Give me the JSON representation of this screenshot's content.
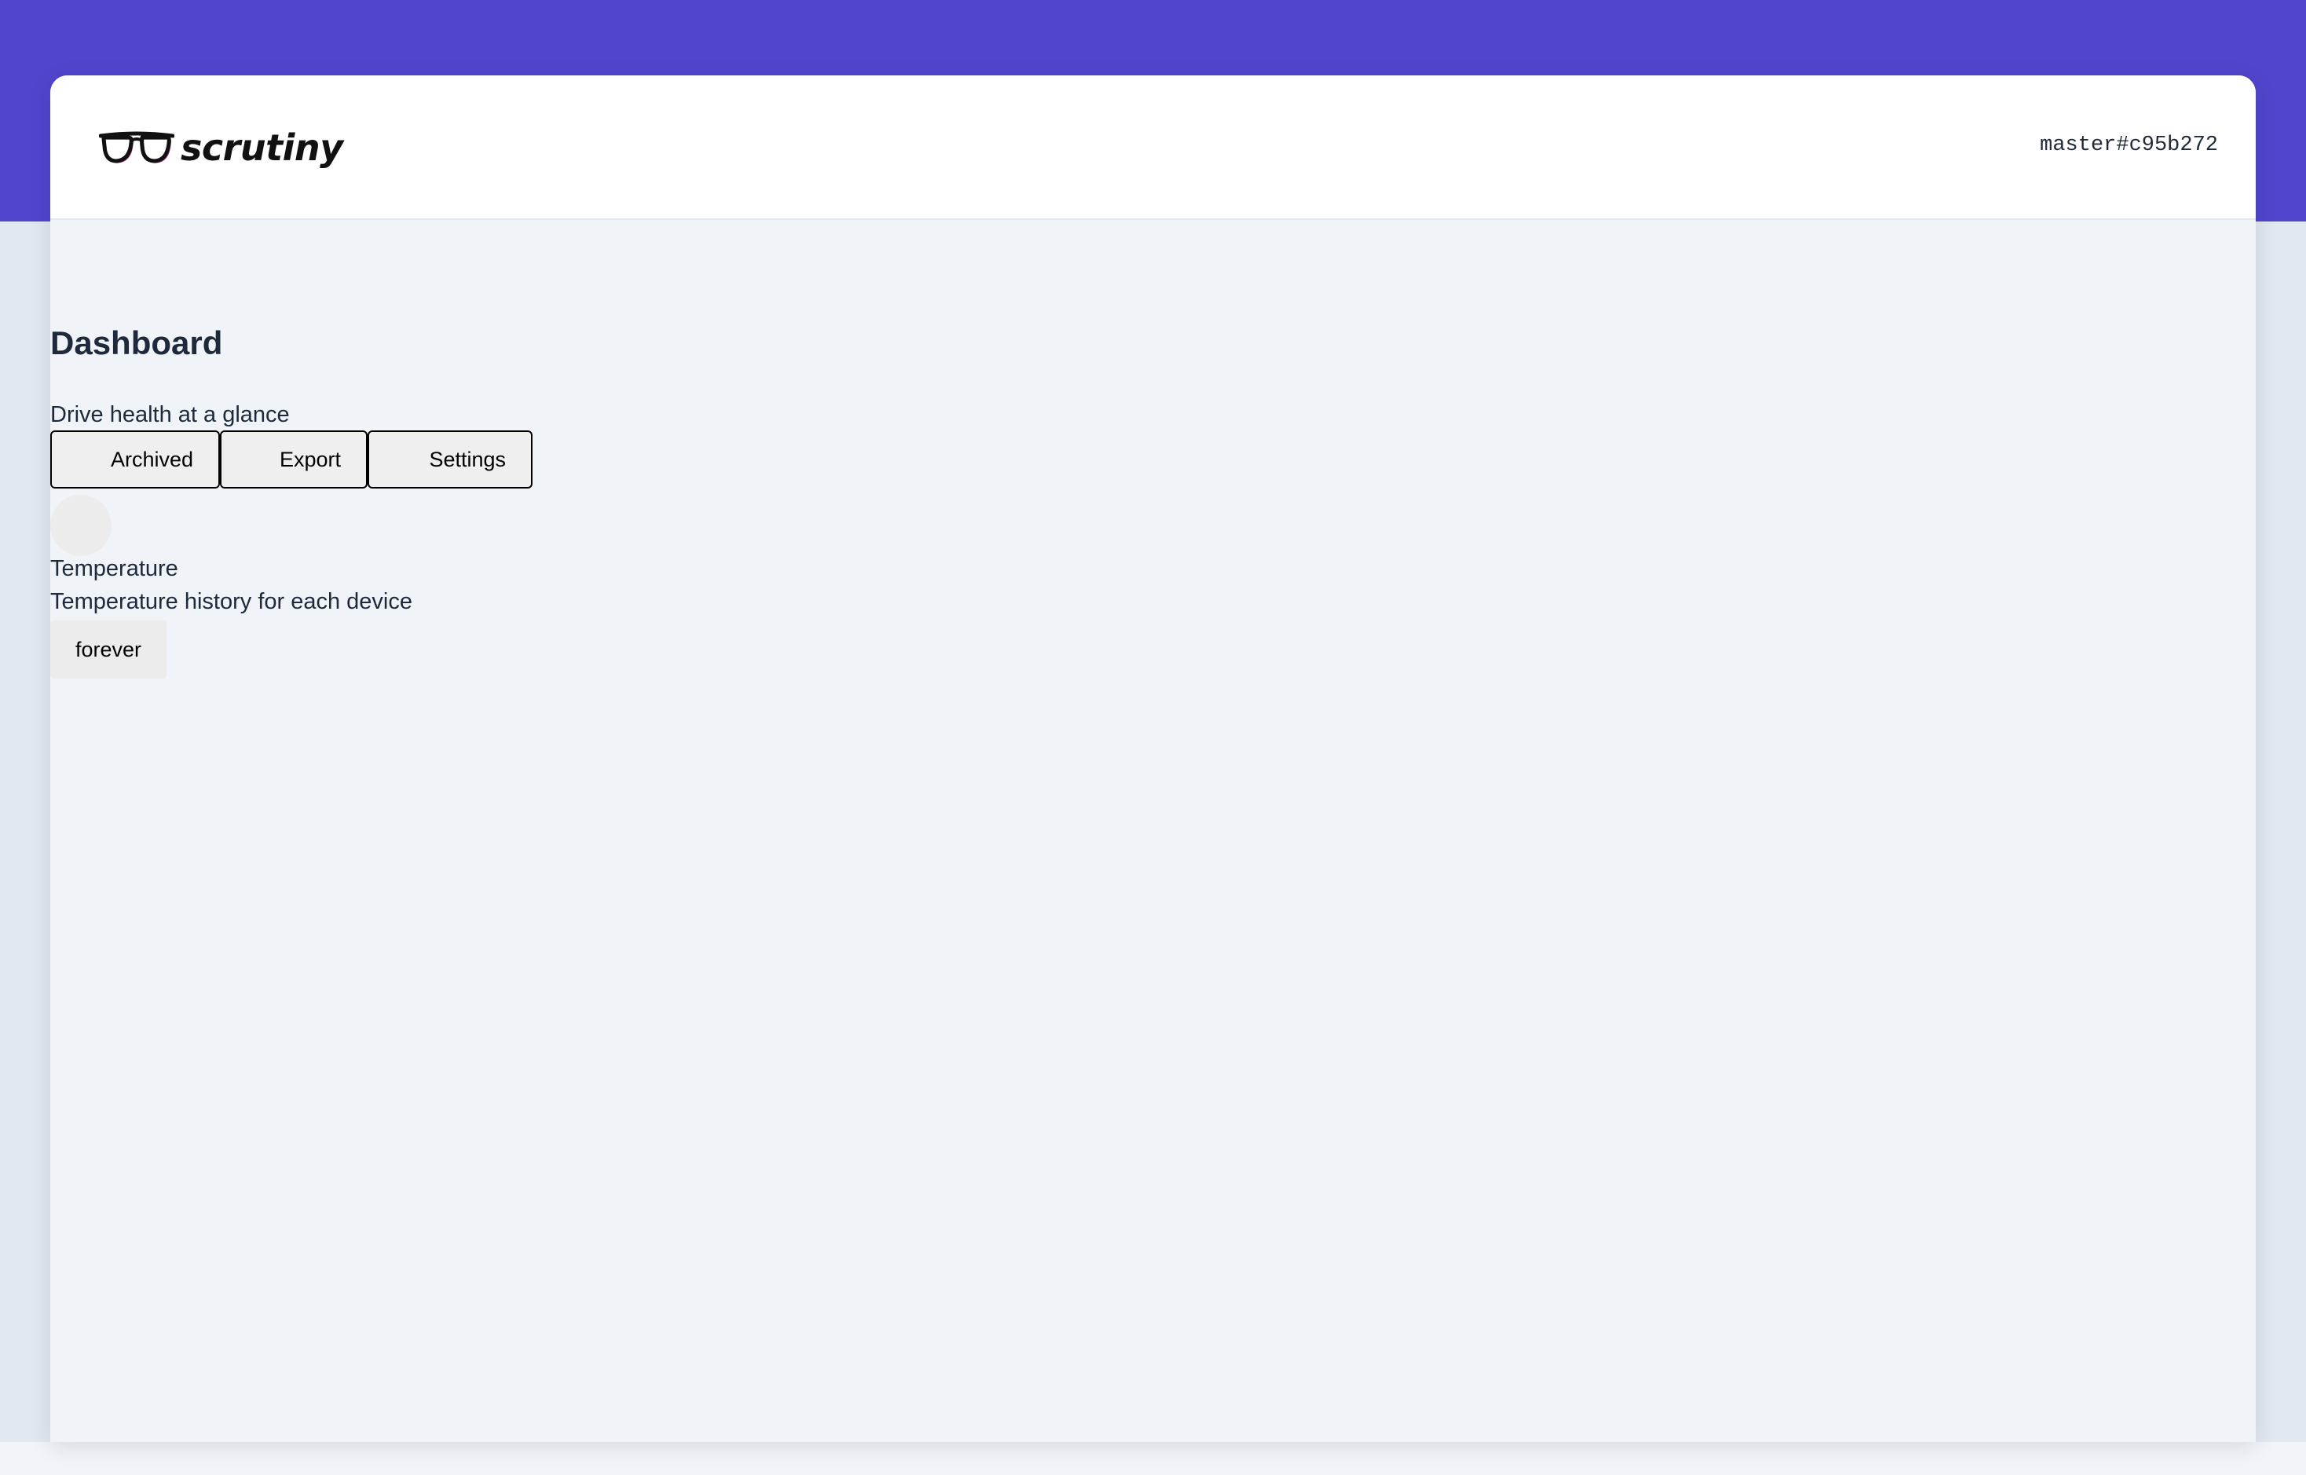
{
  "app": {
    "name": "scrutiny",
    "version": "master#c95b272",
    "logo_icon": "glasses-icon"
  },
  "colors": {
    "brand_band": "#5145cd",
    "page_background": "#f0f4f9",
    "header_background": "#ffffff",
    "text_primary": "#1e293b"
  },
  "dashboard": {
    "title": "Dashboard",
    "subtitle": "Drive health at a glance",
    "actions": [
      {
        "label": "Archived"
      },
      {
        "label": "Export"
      },
      {
        "label": "Settings"
      }
    ]
  },
  "temperature": {
    "title": "Temperature",
    "subtitle": "Temperature history for each device",
    "range_label": "forever"
  }
}
